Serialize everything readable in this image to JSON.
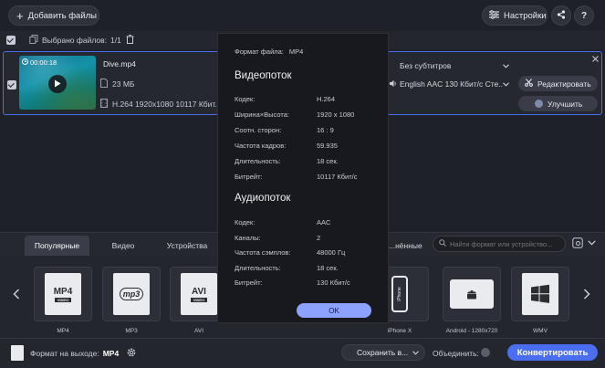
{
  "toolbar": {
    "add_files_label": "Добавить файлы",
    "settings_label": "Настройки",
    "help_label": "?"
  },
  "selection": {
    "selected_label": "Выбрано файлов:",
    "selected_count": "1/1"
  },
  "file": {
    "name": "Dive.mp4",
    "duration": "00:00:18",
    "size": "23 МБ",
    "info": "H.264 1920x1080 10117 Кбит...",
    "subtitles": "Без субтитров",
    "audio": "English AAC 130 Кбит/с Сте...",
    "edit_label": "Редактировать",
    "enhance_label": "Улучшить"
  },
  "tabs": [
    {
      "label": "Популярные",
      "active": true
    },
    {
      "label": "Видео",
      "active": false
    },
    {
      "label": "Устройства",
      "active": false
    },
    {
      "label": "...нённые",
      "active": false
    }
  ],
  "search": {
    "placeholder": "Найти формат или устройство..."
  },
  "formats": [
    {
      "label": "MP4",
      "icon": "mp4-icon"
    },
    {
      "label": "MP3",
      "icon": "mp3-icon"
    },
    {
      "label": "AVI",
      "icon": "avi-icon"
    },
    {
      "label": "iPhone X",
      "icon": "iphone-icon"
    },
    {
      "label": "Android - 1280x720",
      "icon": "android-icon"
    },
    {
      "label": "WMV",
      "icon": "windows-icon"
    }
  ],
  "footer": {
    "output_format_label": "Формат на выходе:",
    "output_format_value": "MP4",
    "save_label": "Сохранить в...",
    "merge_label": "Объединить:",
    "convert_label": "Конвертировать"
  },
  "modal": {
    "format_label": "Формат файла:",
    "format_value": "MP4",
    "video_title": "Видеопоток",
    "video_rows": [
      {
        "label": "Кодек:",
        "value": "H.264"
      },
      {
        "label": "Ширина×Высота:",
        "value": "1920 x 1080"
      },
      {
        "label": "Соотн. сторон:",
        "value": "16 : 9"
      },
      {
        "label": "Частота кадров:",
        "value": "59.935"
      },
      {
        "label": "Длительность:",
        "value": "18 сек."
      },
      {
        "label": "Битрейт:",
        "value": "10117 Кбит/с"
      }
    ],
    "audio_title": "Аудиопоток",
    "audio_rows": [
      {
        "label": "Кодек:",
        "value": "AAC"
      },
      {
        "label": "Каналы:",
        "value": "2"
      },
      {
        "label": "Частота сэмплов:",
        "value": "48000 Гц"
      },
      {
        "label": "Длительность:",
        "value": "18 сек."
      },
      {
        "label": "Битрейт:",
        "value": "130 Кбит/с"
      }
    ],
    "ok_label": "OK"
  },
  "colors": {
    "accent": "#4b6ef0",
    "ok_button": "#8da1ff",
    "background": "#1f2128"
  }
}
